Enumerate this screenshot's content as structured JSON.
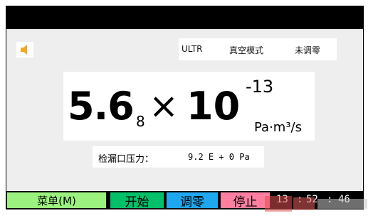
{
  "status": {
    "mode": "ULTR",
    "vacuum": "真空模式",
    "zero_state": "未调零"
  },
  "reading": {
    "mantissa": "5.6",
    "small_digit": "8",
    "times": "×",
    "base": "10",
    "exponent": "-13",
    "unit": "Pa·m³/s"
  },
  "leak_port": {
    "label": "检漏口压力：",
    "value": "9.2 E + 0 Pa"
  },
  "buttons": {
    "menu": "菜单(M)",
    "start": "开始",
    "zero": "调零",
    "stop": "停止"
  },
  "clock": {
    "hours": "13",
    "minutes": "52",
    "seconds": "46",
    "sep": ":"
  },
  "colors": {
    "menu": "#9bf27e",
    "start": "#00c06a",
    "zero": "#1fa8f0",
    "stop": "#ff7fa0",
    "speaker": "#f5a623"
  },
  "icons": {
    "speaker": "speaker-icon"
  }
}
